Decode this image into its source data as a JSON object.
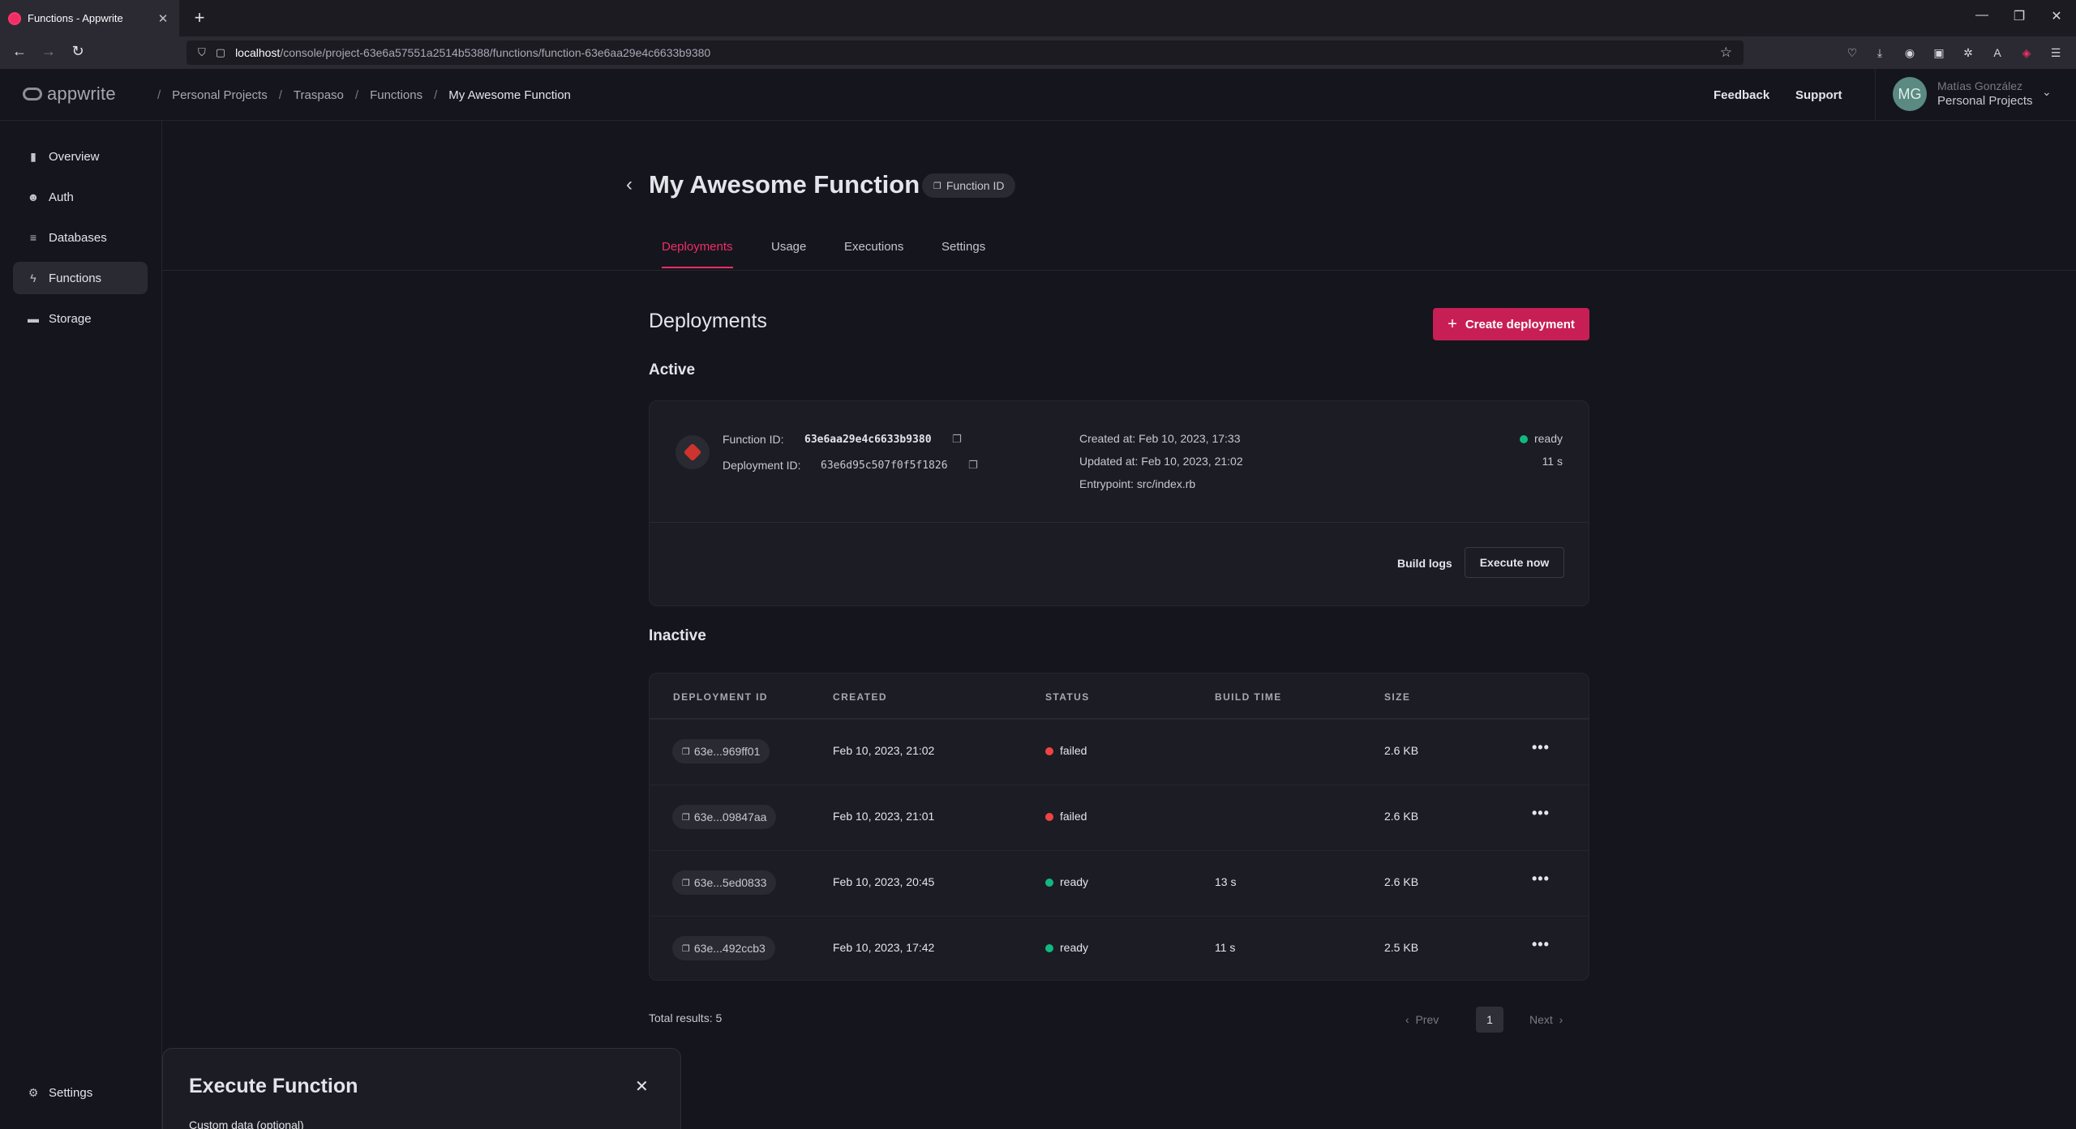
{
  "browser": {
    "tab_title": "Functions - Appwrite",
    "new_tab": "+",
    "url_host": "localhost",
    "url_path": "/console/project-63e6a57551a2514b5388/functions/function-63e6aa29e4c6633b9380"
  },
  "header": {
    "logo": "appwrite",
    "breadcrumbs": [
      "Personal Projects",
      "Traspaso",
      "Functions",
      "My Awesome Function"
    ],
    "feedback": "Feedback",
    "support": "Support",
    "user": {
      "initials": "MG",
      "name": "Matías González",
      "org": "Personal Projects"
    }
  },
  "sidebar": {
    "items": [
      {
        "label": "Overview",
        "icon": "chart-icon"
      },
      {
        "label": "Auth",
        "icon": "users-icon"
      },
      {
        "label": "Databases",
        "icon": "database-icon"
      },
      {
        "label": "Functions",
        "icon": "lightning-icon"
      },
      {
        "label": "Storage",
        "icon": "folder-icon"
      }
    ],
    "settings": "Settings"
  },
  "page": {
    "title": "My Awesome Function",
    "id_tag": "Function ID",
    "tabs": [
      "Deployments",
      "Usage",
      "Executions",
      "Settings"
    ],
    "section_title": "Deployments",
    "create_button": "Create deployment",
    "active_title": "Active",
    "inactive_title": "Inactive"
  },
  "active": {
    "function_id_label": "Function ID:",
    "function_id": "63e6aa29e4c6633b9380",
    "deployment_id_label": "Deployment ID:",
    "deployment_id": "63e6d95c507f0f5f1826",
    "created": "Created at: Feb 10, 2023, 17:33",
    "updated": "Updated at: Feb 10, 2023, 21:02",
    "entrypoint": "Entrypoint: src/index.rb",
    "status": "ready",
    "build_time": "11 s",
    "build_logs": "Build logs",
    "execute": "Execute now"
  },
  "table": {
    "headers": [
      "DEPLOYMENT ID",
      "CREATED",
      "STATUS",
      "BUILD TIME",
      "SIZE"
    ],
    "rows": [
      {
        "id": "63e...969ff01",
        "created": "Feb 10, 2023, 21:02",
        "status": "failed",
        "build": "",
        "size": "2.6 KB"
      },
      {
        "id": "63e...09847aa",
        "created": "Feb 10, 2023, 21:01",
        "status": "failed",
        "build": "",
        "size": "2.6 KB"
      },
      {
        "id": "63e...5ed0833",
        "created": "Feb 10, 2023, 20:45",
        "status": "ready",
        "build": "13 s",
        "size": "2.6 KB"
      },
      {
        "id": "63e...492ccb3",
        "created": "Feb 10, 2023, 17:42",
        "status": "ready",
        "build": "11 s",
        "size": "2.5 KB"
      }
    ]
  },
  "pagination": {
    "total": "Total results: 5",
    "prev": "Prev",
    "page": "1",
    "next": "Next"
  },
  "modal": {
    "title": "Execute Function",
    "label": "Custom data (optional)"
  },
  "colors": {
    "accent": "#f02e65",
    "button": "#c71f55",
    "ready": "#10b981",
    "failed": "#ef4444"
  }
}
